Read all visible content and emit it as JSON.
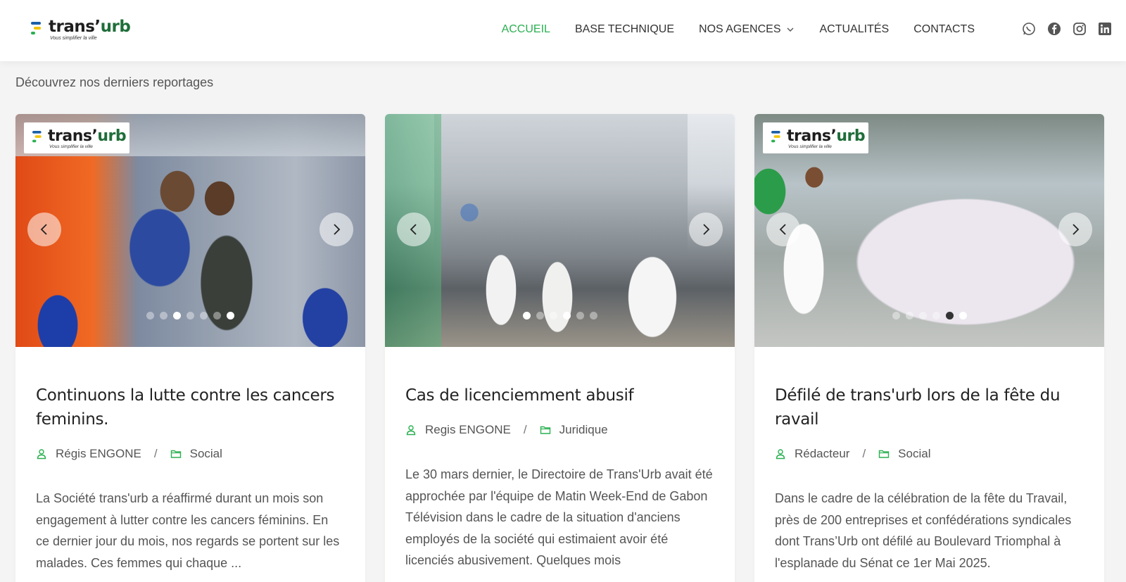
{
  "brand": {
    "name_part1": "trans’",
    "name_part2": "urb",
    "tagline": "Vous simplifier la ville"
  },
  "nav": {
    "items": [
      {
        "label": "ACCUEIL",
        "active": true
      },
      {
        "label": "BASE TECHNIQUE",
        "active": false
      },
      {
        "label": "NOS AGENCES",
        "active": false,
        "dropdown": true
      },
      {
        "label": "ACTUALITÉS",
        "active": false
      },
      {
        "label": "CONTACTS",
        "active": false
      }
    ],
    "socials": [
      "whatsapp-icon",
      "facebook-icon",
      "instagram-icon",
      "linkedin-icon"
    ]
  },
  "intro": "Découvrez nos derniers reportages",
  "colors": {
    "accent": "#2ab051",
    "brand_green": "#1f6e3a",
    "brand_blue": "#1b5fa8",
    "brand_yellow": "#f2c400"
  },
  "cards": [
    {
      "title": "Continuons la lutte contre les cancers feminins.",
      "author": "Régis ENGONE",
      "category": "Social",
      "excerpt": "La Société trans'urb a réaffirmé durant un mois son engagement à lutter contre les cancers féminins. En ce dernier jour du mois, nos regards se portent sur les malades. Ces femmes qui chaque ...",
      "slides": 7,
      "active_slide": 2
    },
    {
      "title": "Cas de licenciemment abusif",
      "author": "Regis ENGONE",
      "category": "Juridique",
      "excerpt": "Le 30 mars dernier, le Directoire de Trans'Urb avait été approchée par l'équipe de Matin Week-End de Gabon Télévision dans le cadre de la situation d'anciens employés de la société qui estimaient avoir été licenciés abusivement. Quelques mois",
      "slides": 6,
      "active_slide": 3
    },
    {
      "title": "Défilé de trans'urb lors de la fête du ravail",
      "author": "Rédacteur",
      "category": "Social",
      "excerpt": "Dans le cadre de la célébration de la fête du Travail, près de 200 entreprises et confédérations syndicales dont Trans’Urb ont défilé au Boulevard Triomphal à l'esplanade du Sénat ce 1er Mai 2025.",
      "slides": 6,
      "active_slide": 5
    }
  ]
}
